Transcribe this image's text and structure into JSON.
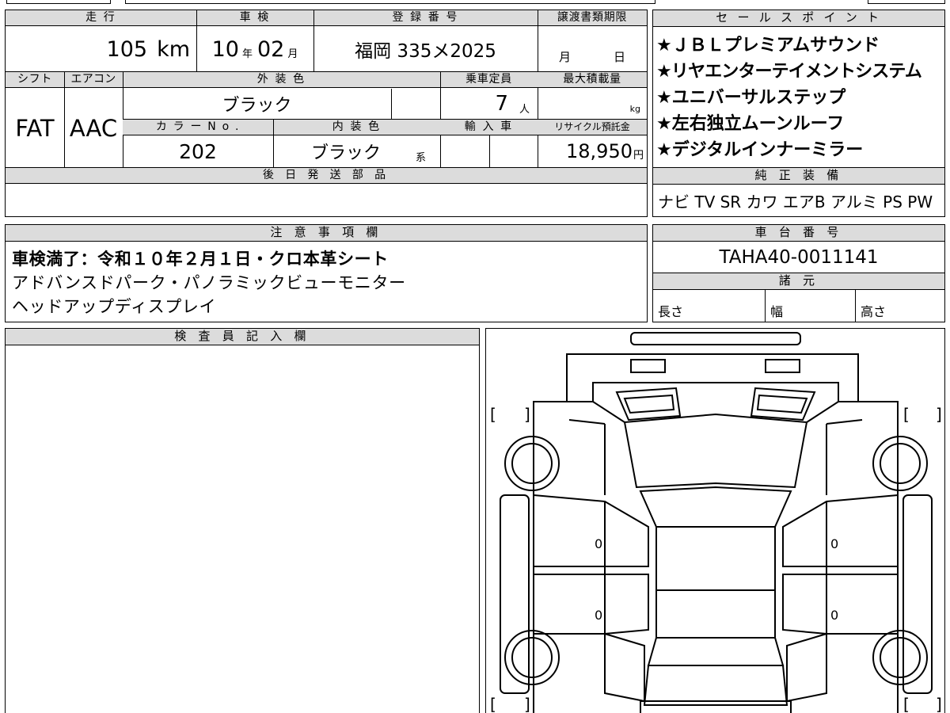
{
  "vehicle": {
    "labels": {
      "mileage": "走 行",
      "inspection": "車 検",
      "registration": "登 録 番 号",
      "transfer_deadline": "譲渡書類期限",
      "shift": "シフト",
      "aircon": "エアコン",
      "exterior_color": "外 装 色",
      "capacity": "乗車定員",
      "max_load": "最大積載量",
      "color_no": "カ ラ ー  N o .",
      "interior_color": "内 装 色",
      "import": "輸 入 車",
      "recycle_fee": "リサイクル預託金",
      "later_parts": "後 日 発 送 部 品"
    },
    "mileage_value": "105",
    "mileage_unit": "km",
    "inspection_year": "10",
    "inspection_year_unit": "年",
    "inspection_month": "02",
    "inspection_month_unit": "月",
    "registration_number": "福岡 335メ2025",
    "transfer_month_unit": "月",
    "transfer_day_unit": "日",
    "shift_value": "FAT",
    "aircon_value": "AAC",
    "exterior_color_value": "ブラック",
    "capacity_value": "7",
    "capacity_unit": "人",
    "max_load_unit": "kg",
    "color_no_value": "202",
    "interior_color_value": "ブラック",
    "interior_color_suffix": "系",
    "recycle_fee_value": "18,950",
    "recycle_fee_unit": "円"
  },
  "sales_points": {
    "title": "セ ー ル ス ポ イ ン ト",
    "items": [
      "★ＪＢＬプレミアムサウンド",
      "★リヤエンターテイメントシステム",
      "★ユニバーサルステップ",
      "★左右独立ムーンルーフ",
      "★デジタルインナーミラー"
    ]
  },
  "genuine_equipment": {
    "title": "純 正 装 備",
    "value": "ナビ TV SR カワ エアB アルミ PS PW"
  },
  "notes": {
    "title": "注 意 事 項 欄",
    "lines": [
      "車検満了：令和１０年２月１日・クロ本革シート",
      "アドバンスドパーク・パノラミックビューモニター",
      "ヘッドアップディスプレイ"
    ]
  },
  "chassis": {
    "title": "車 台 番 号",
    "value": "TAHA40-0011141"
  },
  "specs": {
    "title": "諸 元",
    "length": "長さ",
    "width": "幅",
    "height": "高さ"
  },
  "inspector": {
    "title": "検 査 員 記 入 欄"
  },
  "diagram": {
    "left_upper_mark": "0",
    "left_lower_mark": "0",
    "right_upper_mark": "0",
    "right_lower_mark": "0",
    "bracket_open": "[",
    "bracket_close": "]"
  }
}
